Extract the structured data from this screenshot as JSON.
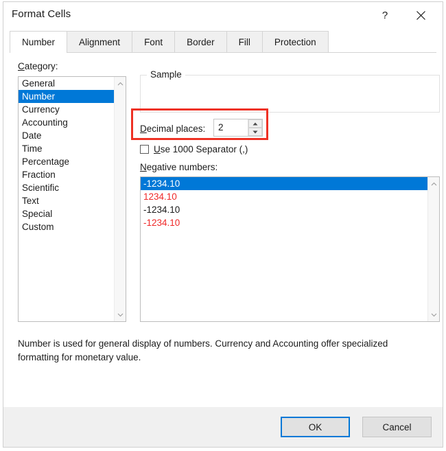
{
  "window": {
    "title": "Format Cells",
    "help_label": "?",
    "help_icon": "question-mark-icon",
    "close_icon": "close-icon"
  },
  "tabs": [
    {
      "label": "Number",
      "active": true
    },
    {
      "label": "Alignment",
      "active": false
    },
    {
      "label": "Font",
      "active": false
    },
    {
      "label": "Border",
      "active": false
    },
    {
      "label": "Fill",
      "active": false
    },
    {
      "label": "Protection",
      "active": false
    }
  ],
  "category": {
    "label_prefix": "C",
    "label_rest": "ategory:",
    "items": [
      {
        "label": "General",
        "selected": false
      },
      {
        "label": "Number",
        "selected": true
      },
      {
        "label": "Currency",
        "selected": false
      },
      {
        "label": "Accounting",
        "selected": false
      },
      {
        "label": "Date",
        "selected": false
      },
      {
        "label": "Time",
        "selected": false
      },
      {
        "label": "Percentage",
        "selected": false
      },
      {
        "label": "Fraction",
        "selected": false
      },
      {
        "label": "Scientific",
        "selected": false
      },
      {
        "label": "Text",
        "selected": false
      },
      {
        "label": "Special",
        "selected": false
      },
      {
        "label": "Custom",
        "selected": false
      }
    ],
    "scroll_up_icon": "chevron-up-icon",
    "scroll_down_icon": "chevron-down-icon"
  },
  "sample": {
    "legend": "Sample",
    "value": ""
  },
  "decimal_places": {
    "label_prefix": "D",
    "label_rest": "ecimal places:",
    "value": "2",
    "spin_up_icon": "spinner-up-icon",
    "spin_down_icon": "spinner-down-icon"
  },
  "separator": {
    "label_prefix": "U",
    "label_rest": "se 1000 Separator (,)",
    "checked": false
  },
  "negative_numbers": {
    "label_prefix": "N",
    "label_rest": "egative numbers:",
    "items": [
      {
        "text": "-1234.10",
        "color": "#ffffff",
        "selected": true
      },
      {
        "text": "1234.10",
        "color": "#ef2929",
        "selected": false
      },
      {
        "text": "-1234.10",
        "color": "#1b1b1b",
        "selected": false
      },
      {
        "text": "-1234.10",
        "color": "#ef2929",
        "selected": false
      }
    ],
    "scroll_up_icon": "chevron-up-icon",
    "scroll_down_icon": "chevron-down-icon"
  },
  "description": "Number is used for general display of numbers.  Currency and Accounting offer specialized formatting for monetary value.",
  "footer": {
    "ok_label": "OK",
    "cancel_label": "Cancel"
  },
  "colors": {
    "selection_blue": "#0078d7",
    "highlight_red": "#ee3124",
    "negative_red": "#ef2929",
    "dialog_chrome": "#f0f0f0"
  },
  "cursor": {
    "icon": "mouse-pointer-icon"
  }
}
